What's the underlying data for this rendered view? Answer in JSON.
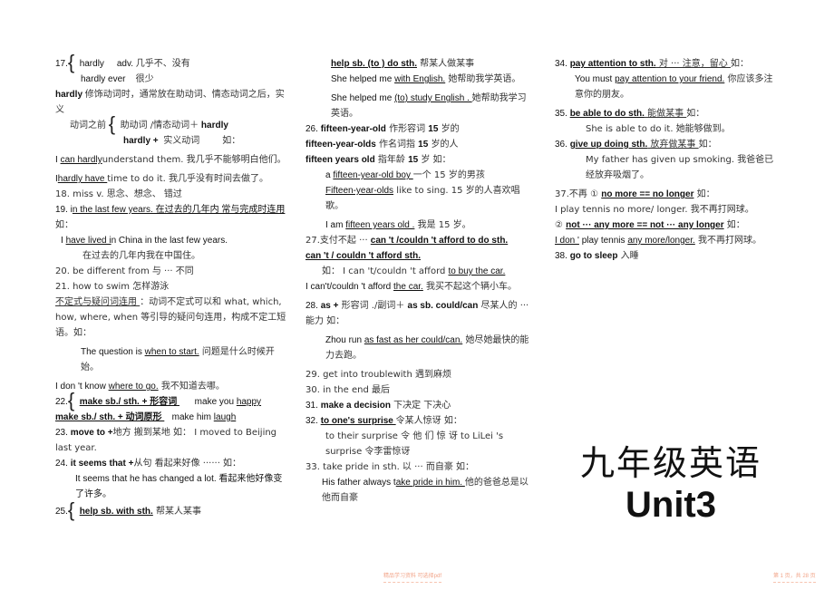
{
  "col1": {
    "i17_num": "17.",
    "i17_a": "hardly",
    "i17_a_pos": "adv.",
    "i17_a_cn": "几乎不、没有",
    "i17_b": "hardly ever",
    "i17_b_cn": "很少",
    "i17_note_bold": "hardly",
    "i17_note": "修饰动词时，通常放在助动词、情态动词之后，实义",
    "i17_before": "动词之前",
    "i17_r1": "助动词 /情态动词＋",
    "i17_r1_b": "hardly",
    "i17_r2_b": "hardly +",
    "i17_r2": "实义动词",
    "i17_ru": "如：",
    "ex1_pre": "I ",
    "ex1_u": "can hardly",
    "ex1_post": "understand them. 我几乎不能够明白他们。",
    "ex2_pre": "I",
    "ex2_u": "hardly have ",
    "ex2_post": "time to do it.   我几乎没有时间去做了。",
    "i18": "18. miss    v.   思念、想念、      错过",
    "i19_pre": "19. i",
    "i19_u": "n the last few    years. 在过去的几年内   常与完成时连用 ",
    "i19_post": "如：",
    "ex3_pre": "I ",
    "ex3_u": "have lived i",
    "ex3_post": "n China in the last few years.",
    "ex3_cn": "在过去的几年内我在中国住。",
    "i20": "20. be different from    与 ··· 不同",
    "i21": "21. how to swim    怎样游泳",
    "i21_u": "不定式与疑问词连用      ",
    "i21_note": "：动词不定式可以和 what, which, how, where, when 等引导的疑问句连用，构成不定工短语。如：",
    "ex4_pre": "The question is ",
    "ex4_u": "when to start.",
    "ex4_post": " 问题是什么时候开始。",
    "ex5_pre": "I don 't know ",
    "ex5_u": "where to go.",
    "ex5_post": "  我不知道去哪。",
    "i22_num": "22.",
    "i22_a": "make sb./ sth. +  形容词   ",
    "i22_a_ex_pre": "make you ",
    "i22_a_ex_u": "happy",
    "i22_b": "make sb./ sth. +  动词原形   ",
    "i22_b_ex_pre": "make him ",
    "i22_b_ex_u": "laugh",
    "i23_num": "23. ",
    "i23_b": "move to +",
    "i23_rest": "地方     搬到某地     如： I moved to Beijing last year.",
    "i24_num": "24. ",
    "i24_b": "it seems that +",
    "i24_rest": "从句     看起来好像   ······     如：",
    "ex6": "It seems that he has changed a lot.    看起来他好像变了许多。",
    "i25_num": "25.",
    "i25_b": "help sb. with sth.",
    "i25_cn": " 帮某人某事"
  },
  "col2": {
    "h1_b": "help sb. (to ) do sth.",
    "h1_cn": " 帮某人做某事",
    "ex1_pre": "She helped me ",
    "ex1_u": "with English.",
    "ex1_post": "   她帮助我学英语。",
    "ex2_pre": "She helped me ",
    "ex2_u": "(to) study English .  ",
    "ex2_post": "   她帮助我学习英语。",
    "i26_num": "26. ",
    "i26_b": "fifteen-year-old",
    "i26_cn": "  作形容词     ",
    "i26_b2": "15",
    "i26_cn2": " 岁的",
    "i26b_b": "fifteen-year-olds",
    "i26b_cn": "  作名词指  ",
    "i26b_b2": "15",
    "i26b_cn2": " 岁的人",
    "i26c_b": "fifteen years old",
    "i26c_cn": "  指年龄     ",
    "i26c_b2": "15",
    "i26c_cn2": " 岁     如：",
    "ex3_pre": "a ",
    "ex3_u": "fifteen-year-old boy  ",
    "ex3_post": "    一个  15 岁的男孩",
    "ex4_u": "Fifteen-year-olds",
    "ex4_post": "  like  to  sing. 15 岁的人喜欢唱歌。",
    "ex5_pre": "I am ",
    "ex5_u": "fifteen years old .",
    "ex5_post": "   我是  15 岁。",
    "i27_num": "27.支付不起  ··· ",
    "i27_a": "can 't /couldn 't afford to do sth.",
    "i27_b": "can 't / couldn 't afford sth.",
    "ex6_pre": "如：  I can 't/couldn 't afford ",
    "ex6_u": "to buy the car.",
    "ex7_pre": "I can't/couldn 't afford ",
    "ex7_u": "the car.",
    "ex7_post": "  我买不起这个辆小车。",
    "i28_num": "28. ",
    "i28_b1": "as +",
    "i28_cn1": "  形容词  ./副词＋  ",
    "i28_b2": "as sb. could/can",
    "i28_cn2": "  尽某人的 ··· 能力     如：",
    "ex8_pre": "Zhou run ",
    "ex8_u": "as fast as her could/can.",
    "ex8_post": " 她尽她最快的能力去跑。",
    "i29": "29. get into troublewith    遇到麻烦",
    "i30": "30. in the end   最后",
    "i31_num": "31. ",
    "i31_b": "make a decision",
    "i31_cn": " 下决定      下决心",
    "i32_num": "32. ",
    "i32_b": "to one's surprise ",
    "i32_cn": "令某人惊讶       如：",
    "ex9": "to  their  surprise    令 他 们 惊 讶     to  LiLei 's surprise 令李雷惊讶",
    "i33": "33. take pride in sth.   以 ··· 而自豪      如：",
    "ex10_pre": "His father always t",
    "ex10_u": "ake pride in him.   ",
    "ex10_post": "   他的爸爸总是以他而自豪"
  },
  "col3": {
    "i34_num": "34. ",
    "i34_b": "pay attention to sth.",
    "i34_ucn": "  对 ··· 注意，留心   ",
    "i34_post": "    如：",
    "ex1_pre": "You must ",
    "ex1_u": "pay attention to your friend.",
    "ex1_post": "    你应该多注意你的朋友。",
    "i35_num": "35. ",
    "i35_b": "be able to do sth.",
    "i35_ucn": " 能做某事   ",
    "i35_post": "    如：",
    "ex2": "She is able to do it.  她能够做到。",
    "i36_num": "36. ",
    "i36_b": "give up doing sth.",
    "i36_ucn": " 放弃做某事   ",
    "i36_post": "    如：",
    "ex3": "My father has given up smoking.    我爸爸已经放弃吸烟了。",
    "i37_pre": "37.不再 ① ",
    "i37_b": "no more == no longer",
    "i37_post": " 如：",
    "ex4": "I play tennis no more/ longer. 我不再打网球。",
    "i37b_pre": "② ",
    "i37b_b": "not ··· any more == not  ··· any longer",
    "i37b_post": "     如：",
    "ex5_u": "I don '",
    "ex5_mid": " play tennis ",
    "ex5_u2": "any more/longer.",
    "ex5_post": "   我不再打网球。",
    "i38_num": "38. ",
    "i38_b": "go to sleep",
    "i38_cn": " 入睡"
  },
  "title": {
    "cn": "九年级英语",
    "en": "Unit3"
  },
  "footer": {
    "left": "精品学习资料     可选择pdf",
    "right": "第 1 页，共 28 页"
  }
}
